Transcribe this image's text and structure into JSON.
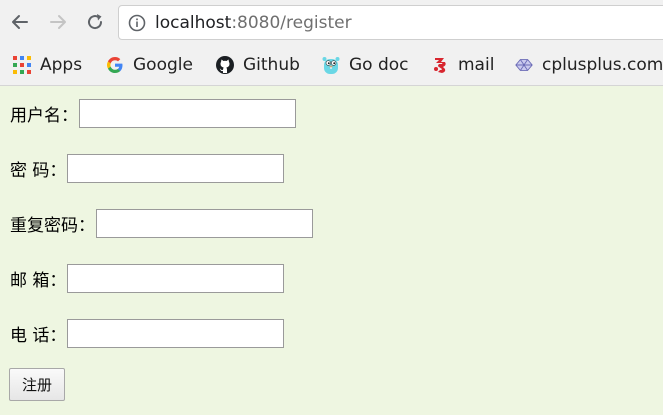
{
  "browser": {
    "url_host": "localhost",
    "url_rest": ":8080/register",
    "back_icon": "back-arrow-icon",
    "forward_icon": "forward-arrow-icon",
    "reload_icon": "reload-icon",
    "info_icon": "info-icon"
  },
  "bookmarks": [
    {
      "label": "Apps",
      "icon": "apps-grid-icon"
    },
    {
      "label": "Google",
      "icon": "google-icon"
    },
    {
      "label": "Github",
      "icon": "github-icon"
    },
    {
      "label": "Go doc",
      "icon": "gopher-icon"
    },
    {
      "label": "mail",
      "icon": "mail-163-icon"
    },
    {
      "label": "cplusplus.com",
      "icon": "cplusplus-icon"
    }
  ],
  "form": {
    "username_label": "用户名：",
    "password_label": "密 码：",
    "confirm_label": "重复密码：",
    "email_label": "邮 箱：",
    "phone_label": "电 话：",
    "username_value": "",
    "password_value": "",
    "confirm_value": "",
    "email_value": "",
    "phone_value": "",
    "submit_label": "注册"
  },
  "colors": {
    "page_background": "#eef6e1",
    "chrome_background": "#f1f1f1"
  }
}
